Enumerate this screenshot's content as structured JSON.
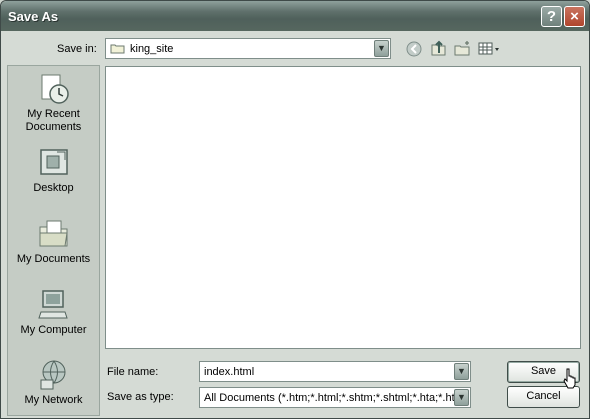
{
  "window": {
    "title": "Save As"
  },
  "titlebar": {
    "help_symbol": "?",
    "close_symbol": "×"
  },
  "location": {
    "label": "Save in:",
    "value": "king_site",
    "icon": "folder-icon"
  },
  "toolbar": [
    "back-icon",
    "up-folder-icon",
    "new-folder-icon",
    "views-menu-icon"
  ],
  "places": [
    {
      "label": "My Recent\nDocuments",
      "icon": "recent-documents-icon"
    },
    {
      "label": "Desktop",
      "icon": "desktop-icon"
    },
    {
      "label": "My Documents",
      "icon": "my-documents-icon"
    },
    {
      "label": "My Computer",
      "icon": "my-computer-icon"
    },
    {
      "label": "My Network",
      "icon": "my-network-icon"
    }
  ],
  "form": {
    "filename_label": "File name:",
    "filename_value": "index.html",
    "filetype_label": "Save as type:",
    "filetype_value": "All Documents (*.htm;*.html;*.shtm;*.shtml;*.hta;*.htc;*"
  },
  "buttons": {
    "save": "Save",
    "cancel": "Cancel"
  }
}
